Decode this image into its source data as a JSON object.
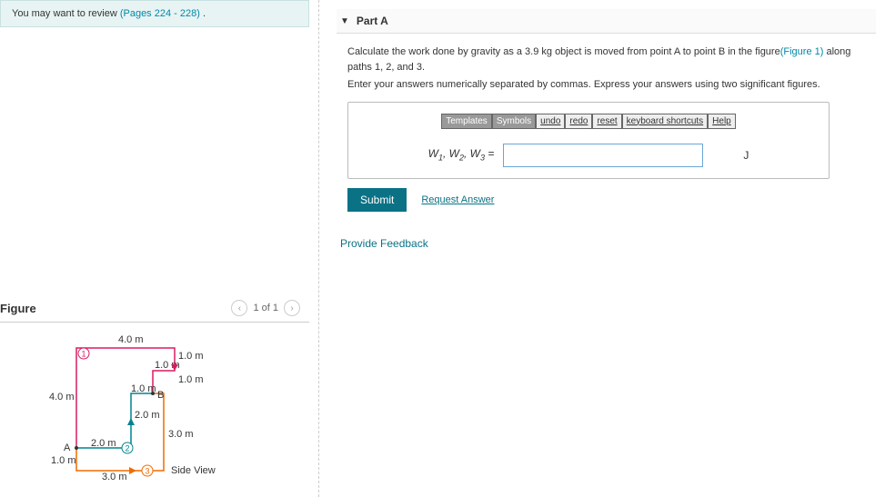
{
  "review": {
    "prefix": "You may want to review ",
    "link": "(Pages 224 - 228)",
    "suffix": " ."
  },
  "figure": {
    "title": "Figure",
    "nav_text": "1 of 1",
    "side_label": "Side View",
    "labels": {
      "top": "4.0 m",
      "tr1": "1.0 m",
      "tr1b": "1.0 m",
      "tr2": "1.0 m",
      "mid_left": "1.0 m",
      "left": "4.0 m",
      "pointA": "A",
      "pointB": "B",
      "seg20a": "2.0 m",
      "seg30": "3.0 m",
      "seg20b": "2.0 m",
      "seg30b": "3.0 m",
      "bl": "1.0 m",
      "n1": "1",
      "n2": "2",
      "n3": "3"
    }
  },
  "part": {
    "title": "Part A",
    "instr1_a": "Calculate the work done by gravity as a 3.9 kg object is moved from point A to point B in the figure",
    "instr1_link": "(Figure 1)",
    "instr1_b": " along paths 1, 2, and 3.",
    "instr2": "Enter your answers numerically separated by commas. Express your answers using two significant figures.",
    "toolbar": {
      "templates": "Templates",
      "symbols": "Symbols",
      "undo": "undo",
      "redo": "redo",
      "reset": "reset",
      "keyboard": "keyboard shortcuts",
      "help": "Help"
    },
    "lhs_w1": "W",
    "lhs_sub1": "1",
    "lhs_comma1": ", ",
    "lhs_w2": "W",
    "lhs_sub2": "2",
    "lhs_comma2": ", ",
    "lhs_w3": "W",
    "lhs_sub3": "3",
    "lhs_eq": " =",
    "input_value": "",
    "unit": "J",
    "submit": "Submit",
    "request": "Request Answer",
    "feedback": "Provide Feedback"
  }
}
